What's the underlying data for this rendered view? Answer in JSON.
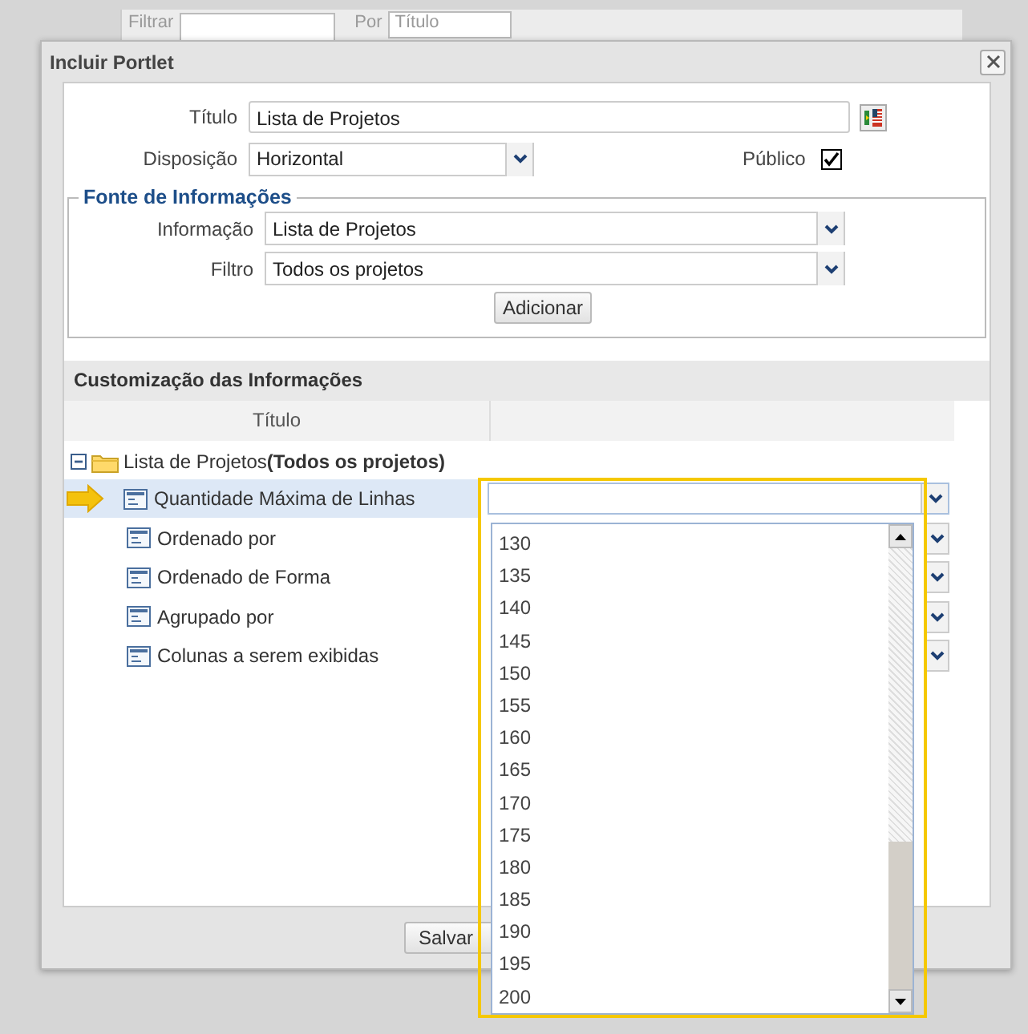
{
  "background_toolbar": {
    "filter_label": "Filtrar",
    "by_label": "Por",
    "by_value": "Título"
  },
  "dialog": {
    "title": "Incluir Portlet"
  },
  "form": {
    "title_label": "Título",
    "title_value": "Lista de Projetos",
    "layout_label": "Disposição",
    "layout_value": "Horizontal",
    "public_label": "Público",
    "public_checked": true
  },
  "source": {
    "legend": "Fonte de Informações",
    "fields": [
      {
        "label": "Informação",
        "value": "Lista de Projetos"
      },
      {
        "label": "Filtro",
        "value": "Todos os projetos"
      }
    ],
    "add_button": "Adicionar"
  },
  "customization": {
    "title": "Customização das Informações",
    "columns": [
      "Título"
    ],
    "tree": {
      "label": "Lista de Projetos**(Todos os projetos)**",
      "expanded": true,
      "children": [
        {
          "label": "Quantidade Máxima de Linhas",
          "selected": true
        },
        {
          "label": "Ordenado por",
          "selected": false
        },
        {
          "label": "Ordenado de Forma",
          "selected": false
        },
        {
          "label": "Agrupado por",
          "selected": false
        },
        {
          "label": "Colunas a serem exibidas",
          "selected": false
        }
      ]
    }
  },
  "dropdown": {
    "options": [
      "130",
      "135",
      "140",
      "145",
      "150",
      "155",
      "160",
      "165",
      "170",
      "175",
      "180",
      "185",
      "190",
      "195",
      "200"
    ]
  },
  "save_button": "Salvar"
}
